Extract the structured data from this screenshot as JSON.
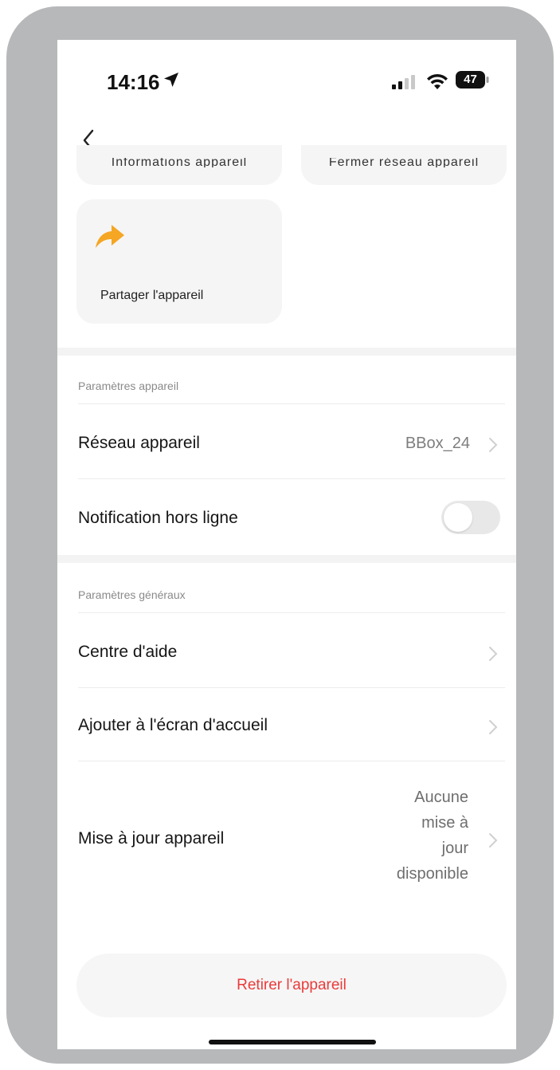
{
  "status_bar": {
    "time": "14:16",
    "battery": "47"
  },
  "tiles": {
    "partial_left": "Informations appareil",
    "partial_right": "Fermer réseau appareil",
    "share_label": "Partager l'appareil"
  },
  "device_settings": {
    "section_label": "Paramètres appareil",
    "network_label": "Réseau appareil",
    "network_value": "BBox_24",
    "offline_notification_label": "Notification hors ligne",
    "offline_notification_enabled": false
  },
  "general_settings": {
    "section_label": "Paramètres généraux",
    "help_label": "Centre d'aide",
    "home_screen_label": "Ajouter à l'écran d'accueil",
    "update_label": "Mise à jour appareil",
    "update_value_lines": [
      "Aucune",
      "mise à",
      "jour",
      "disponible"
    ]
  },
  "remove_button_label": "Retirer l'appareil",
  "colors": {
    "frame": "#b7b8ba",
    "accent_orange": "#f5a623",
    "danger_red": "#ea3b3b",
    "tile_bg": "#f5f5f5"
  }
}
